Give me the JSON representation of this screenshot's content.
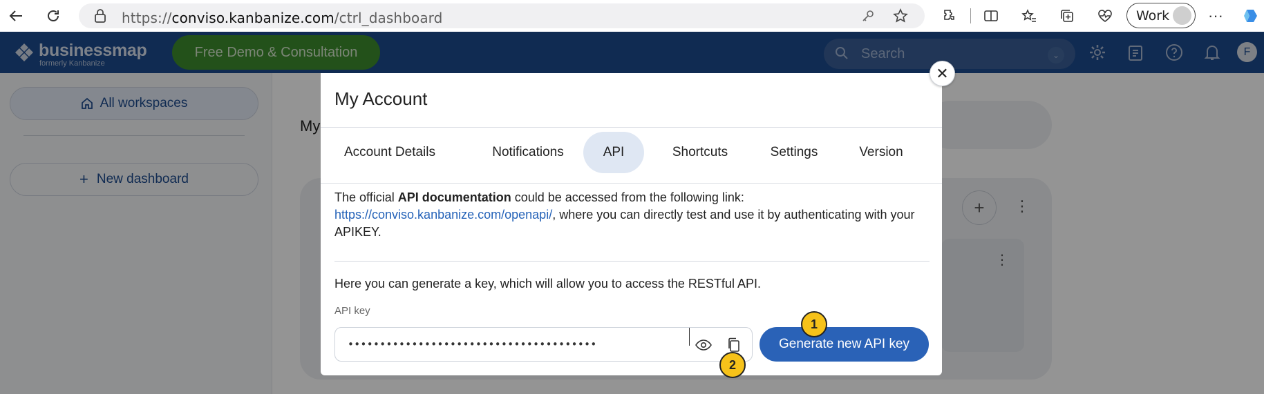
{
  "browser": {
    "url_prefix": "https://",
    "url_host": "conviso.kanbanize.com",
    "url_path": "/ctrl_dashboard",
    "profile_label": "Work"
  },
  "app_header": {
    "logo_name": "businessmap",
    "logo_subtitle": "formerly Kanbanize",
    "demo_button": "Free Demo & Consultation",
    "search_placeholder": "Search",
    "user_initial": "F"
  },
  "sidebar": {
    "all_workspaces": "All workspaces",
    "new_dashboard": "New dashboard"
  },
  "main": {
    "title_fragment": "My"
  },
  "modal": {
    "title": "My Account",
    "tabs": [
      {
        "label": "Account Details",
        "active": false
      },
      {
        "label": "Notifications",
        "active": false
      },
      {
        "label": "API",
        "active": true
      },
      {
        "label": "Shortcuts",
        "active": false
      },
      {
        "label": "Settings",
        "active": false
      },
      {
        "label": "Version",
        "active": false
      }
    ],
    "doc_intro": "The official ",
    "doc_bold": "API documentation",
    "doc_after": " could be accessed from the following link:",
    "doc_link": "https://conviso.kanbanize.com/openapi/",
    "doc_tail": ", where you can directly test and use it by authenticating with your APIKEY.",
    "generate_text": "Here you can generate a key, which will allow you to access the RESTful API.",
    "api_key_label": "API key",
    "api_key_masked": "•••••••••••••••••••••••••••••••••••••••",
    "generate_button": "Generate new API key"
  },
  "markers": [
    "1",
    "2"
  ],
  "colors": {
    "header_bg": "#1d4a8d",
    "demo_green": "#3d8c2d",
    "primary_blue": "#2a62b7",
    "marker_yellow": "#f6c21a",
    "active_tab_bg": "#dfe7f3"
  }
}
